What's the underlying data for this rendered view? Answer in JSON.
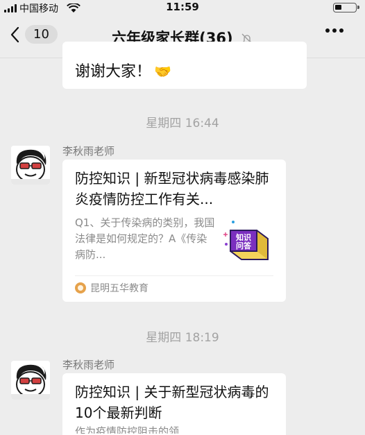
{
  "status_bar": {
    "carrier": "中国移动",
    "time": "11:59",
    "battery_level": 0.35
  },
  "nav": {
    "back_count": "10",
    "title": "六年级家长群(36)"
  },
  "messages": {
    "top_bubble": {
      "text": "谢谢大家！",
      "emoji": "🤝"
    },
    "timestamp_1": "星期四 16:44",
    "msg1": {
      "sender": "李秋雨老师",
      "title": "防控知识 | 新型冠状病毒感染肺炎疫情防控工作有关...",
      "desc": "Q1、关于传染病的类别，我国法律是如何规定的？A《传染病防...",
      "thumb_text": "知识问答",
      "source": "昆明五华教育"
    },
    "timestamp_2": "星期四 18:19",
    "msg2": {
      "sender": "李秋雨老师",
      "title": "防控知识 | 关于新型冠状病毒的10个最新判断",
      "desc": "作为疫情防控阻击的领"
    }
  }
}
